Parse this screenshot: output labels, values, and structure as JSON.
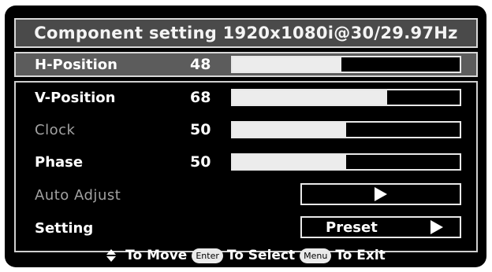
{
  "osd": {
    "title": "Component setting 1920x1080i@30/29.97Hz",
    "rows": [
      {
        "label": "H-Position",
        "value": "48",
        "level": 48,
        "selected": true,
        "enabled": true
      },
      {
        "label": "V-Position",
        "value": "68",
        "level": 68,
        "enabled": true
      },
      {
        "label": "Clock",
        "value": "50",
        "level": 50,
        "enabled": false
      },
      {
        "label": "Phase",
        "value": "50",
        "level": 50,
        "enabled": true
      },
      {
        "label": "Auto Adjust",
        "enabled": false,
        "icon": "play-arrow-icon"
      },
      {
        "label": "Setting",
        "option": "Preset",
        "enabled": true,
        "icon": "play-arrow-icon"
      }
    ],
    "footer": {
      "move_icon": "up-down-arrows-icon",
      "move_text": "To Move",
      "enter_key": "Enter",
      "select_text": "To Select",
      "menu_key": "Menu",
      "exit_text": "To Exit"
    }
  },
  "colors": {
    "background": "#000000",
    "title_bar": "#4a4a4a",
    "selected_row": "#5c5c5c",
    "slider_fill": "#ececec",
    "disabled_text": "#a2a2a2"
  }
}
